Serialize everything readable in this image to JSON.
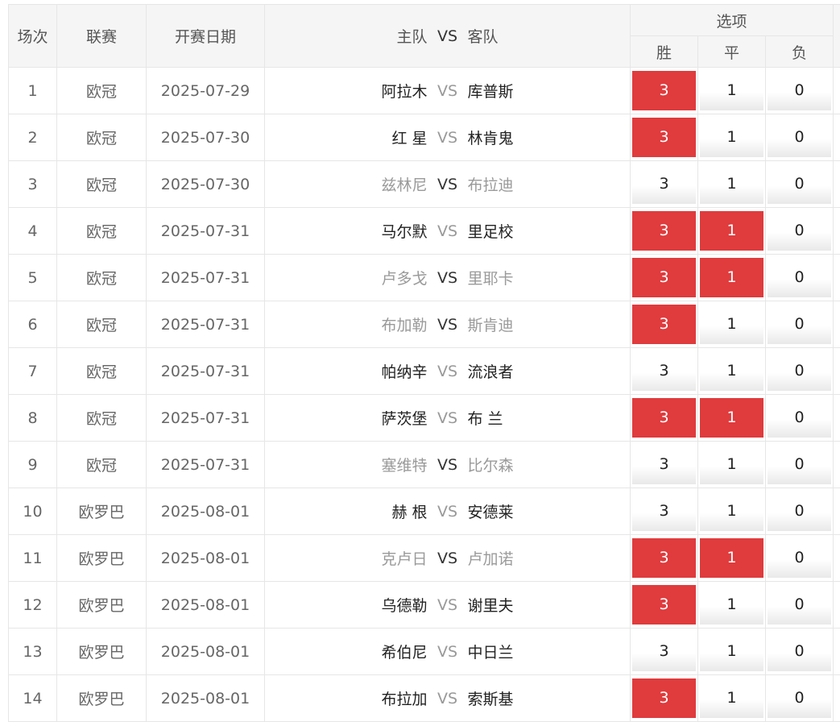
{
  "header": {
    "idx": "场次",
    "league": "联赛",
    "date": "开赛日期",
    "home": "主队",
    "vs": "VS",
    "away": "客队",
    "options": "选项",
    "win": "胜",
    "draw": "平",
    "lose": "负"
  },
  "colors": {
    "selected": "#e03b3d",
    "header_bg": "#f5f5f5"
  },
  "rows": [
    {
      "idx": "1",
      "league": "欧冠",
      "date": "2025-07-29",
      "home": "阿拉木",
      "vs": "VS",
      "away": "库普斯",
      "win": "3",
      "draw": "1",
      "lose": "0",
      "muted": false,
      "sel": [
        true,
        false,
        false
      ]
    },
    {
      "idx": "2",
      "league": "欧冠",
      "date": "2025-07-30",
      "home": "红 星",
      "vs": "VS",
      "away": "林肯鬼",
      "win": "3",
      "draw": "1",
      "lose": "0",
      "muted": false,
      "sel": [
        true,
        false,
        false
      ]
    },
    {
      "idx": "3",
      "league": "欧冠",
      "date": "2025-07-30",
      "home": "兹林尼",
      "vs": "VS",
      "away": "布拉迪",
      "win": "3",
      "draw": "1",
      "lose": "0",
      "muted": true,
      "sel": [
        false,
        false,
        false
      ]
    },
    {
      "idx": "4",
      "league": "欧冠",
      "date": "2025-07-31",
      "home": "马尔默",
      "vs": "VS",
      "away": "里足校",
      "win": "3",
      "draw": "1",
      "lose": "0",
      "muted": false,
      "sel": [
        true,
        true,
        false
      ]
    },
    {
      "idx": "5",
      "league": "欧冠",
      "date": "2025-07-31",
      "home": "卢多戈",
      "vs": "VS",
      "away": "里耶卡",
      "win": "3",
      "draw": "1",
      "lose": "0",
      "muted": true,
      "sel": [
        true,
        true,
        false
      ]
    },
    {
      "idx": "6",
      "league": "欧冠",
      "date": "2025-07-31",
      "home": "布加勒",
      "vs": "VS",
      "away": "斯肯迪",
      "win": "3",
      "draw": "1",
      "lose": "0",
      "muted": true,
      "sel": [
        true,
        false,
        false
      ]
    },
    {
      "idx": "7",
      "league": "欧冠",
      "date": "2025-07-31",
      "home": "帕纳辛",
      "vs": "VS",
      "away": "流浪者",
      "win": "3",
      "draw": "1",
      "lose": "0",
      "muted": false,
      "sel": [
        false,
        false,
        false
      ]
    },
    {
      "idx": "8",
      "league": "欧冠",
      "date": "2025-07-31",
      "home": "萨茨堡",
      "vs": "VS",
      "away": "布 兰",
      "win": "3",
      "draw": "1",
      "lose": "0",
      "muted": false,
      "sel": [
        true,
        true,
        false
      ]
    },
    {
      "idx": "9",
      "league": "欧冠",
      "date": "2025-07-31",
      "home": "塞维特",
      "vs": "VS",
      "away": "比尔森",
      "win": "3",
      "draw": "1",
      "lose": "0",
      "muted": true,
      "sel": [
        false,
        false,
        false
      ]
    },
    {
      "idx": "10",
      "league": "欧罗巴",
      "date": "2025-08-01",
      "home": "赫 根",
      "vs": "VS",
      "away": "安德莱",
      "win": "3",
      "draw": "1",
      "lose": "0",
      "muted": false,
      "sel": [
        false,
        false,
        false
      ]
    },
    {
      "idx": "11",
      "league": "欧罗巴",
      "date": "2025-08-01",
      "home": "克卢日",
      "vs": "VS",
      "away": "卢加诺",
      "win": "3",
      "draw": "1",
      "lose": "0",
      "muted": true,
      "sel": [
        true,
        true,
        false
      ]
    },
    {
      "idx": "12",
      "league": "欧罗巴",
      "date": "2025-08-01",
      "home": "乌德勒",
      "vs": "VS",
      "away": "谢里夫",
      "win": "3",
      "draw": "1",
      "lose": "0",
      "muted": false,
      "sel": [
        true,
        false,
        false
      ]
    },
    {
      "idx": "13",
      "league": "欧罗巴",
      "date": "2025-08-01",
      "home": "希伯尼",
      "vs": "VS",
      "away": "中日兰",
      "win": "3",
      "draw": "1",
      "lose": "0",
      "muted": false,
      "sel": [
        false,
        false,
        false
      ]
    },
    {
      "idx": "14",
      "league": "欧罗巴",
      "date": "2025-08-01",
      "home": "布拉加",
      "vs": "VS",
      "away": "索斯基",
      "win": "3",
      "draw": "1",
      "lose": "0",
      "muted": false,
      "sel": [
        true,
        false,
        false
      ]
    }
  ]
}
